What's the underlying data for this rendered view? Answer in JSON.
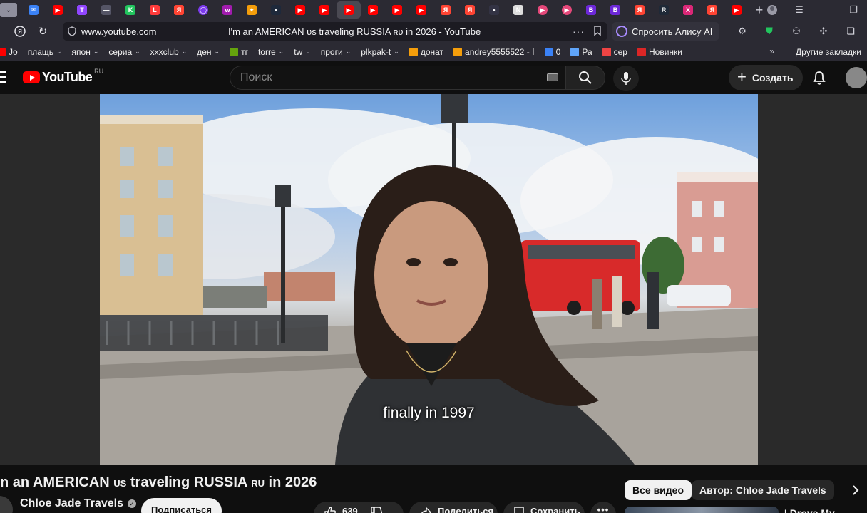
{
  "browser": {
    "tab_favicons": [
      {
        "icon": "mail-icon",
        "color": "#3b82f6",
        "glyph": "✉"
      },
      {
        "icon": "youtube-icon",
        "color": "#ff0000",
        "glyph": "▶"
      },
      {
        "icon": "twitch-icon",
        "color": "#9146ff",
        "glyph": "T"
      },
      {
        "icon": "site-icon",
        "color": "#555566",
        "glyph": "—"
      },
      {
        "icon": "kinopoisk-icon",
        "color": "#22c55e",
        "glyph": "K"
      },
      {
        "icon": "live-icon",
        "color": "#ff3b3b",
        "glyph": "L"
      },
      {
        "icon": "yandex-icon",
        "color": "#ff4433",
        "glyph": "Я"
      },
      {
        "icon": "circle-icon",
        "color": "#7c3aed",
        "glyph": "◯"
      },
      {
        "icon": "wb-icon",
        "color": "#a21caf",
        "glyph": "w"
      },
      {
        "icon": "fire-icon",
        "color": "#f59e0b",
        "glyph": "✦"
      },
      {
        "icon": "dark-site-icon",
        "color": "#1e293b",
        "glyph": "•"
      },
      {
        "icon": "youtube-icon",
        "color": "#ff0000",
        "glyph": "▶"
      },
      {
        "icon": "youtube-icon",
        "color": "#ff0000",
        "glyph": "▶"
      },
      {
        "icon": "youtube-icon",
        "color": "#ff0000",
        "glyph": "▶"
      },
      {
        "icon": "youtube-icon",
        "color": "#ff0000",
        "glyph": "▶"
      },
      {
        "icon": "youtube-icon",
        "color": "#ff0000",
        "glyph": "▶"
      },
      {
        "icon": "youtube-icon",
        "color": "#ff0000",
        "glyph": "▶"
      },
      {
        "icon": "yandex-icon",
        "color": "#ff4433",
        "glyph": "Я"
      },
      {
        "icon": "yandex-icon",
        "color": "#ff4433",
        "glyph": "Я"
      },
      {
        "icon": "dots-icon",
        "color": "#333344",
        "glyph": "•"
      },
      {
        "icon": "news-icon",
        "color": "#dddddd",
        "glyph": "N"
      },
      {
        "icon": "play-circle-icon",
        "color": "#e5487a",
        "glyph": "▶"
      },
      {
        "icon": "play-circle-icon",
        "color": "#e5487a",
        "glyph": "▶"
      },
      {
        "icon": "b-icon",
        "color": "#6d28d9",
        "glyph": "B"
      },
      {
        "icon": "b-icon",
        "color": "#6d28d9",
        "glyph": "B"
      },
      {
        "icon": "yandex-icon",
        "color": "#ff4433",
        "glyph": "Я"
      },
      {
        "icon": "r-icon",
        "color": "#1f2937",
        "glyph": "R"
      },
      {
        "icon": "x-icon",
        "color": "#db2777",
        "glyph": "X"
      },
      {
        "icon": "yandex-icon",
        "color": "#ff4433",
        "glyph": "Я"
      },
      {
        "icon": "youtube-icon",
        "color": "#ff0000",
        "glyph": "▶"
      }
    ],
    "active_tab_index": 13,
    "url": "www.youtube.com",
    "page_title": "I'm an AMERICAN ᴜs traveling RUSSIA ʀᴜ in 2026 - YouTube",
    "alice_label": "Спросить Алису AI",
    "bookmarks": [
      {
        "label": "Jo",
        "color": "#ff0000",
        "chevron": false
      },
      {
        "label": "плащь",
        "color": "",
        "chevron": true
      },
      {
        "label": "япон",
        "color": "",
        "chevron": true
      },
      {
        "label": "сериа",
        "color": "",
        "chevron": true
      },
      {
        "label": "xxxclub",
        "color": "",
        "chevron": true
      },
      {
        "label": "ден",
        "color": "",
        "chevron": true
      },
      {
        "label": "тг",
        "color": "#65a30d",
        "chevron": false
      },
      {
        "label": "torre",
        "color": "",
        "chevron": true
      },
      {
        "label": "tw",
        "color": "",
        "chevron": true
      },
      {
        "label": "проги",
        "color": "",
        "chevron": true
      },
      {
        "label": "plkpak-t",
        "color": "",
        "chevron": true
      },
      {
        "label": "донат",
        "color": "#f59e0b",
        "chevron": false
      },
      {
        "label": "andrey5555522 - Ⅰ",
        "color": "#f59e0b",
        "chevron": false
      },
      {
        "label": "0",
        "color": "#3b82f6",
        "chevron": false
      },
      {
        "label": "Ра",
        "color": "#60a5fa",
        "chevron": false
      },
      {
        "label": "сер",
        "color": "#ef4444",
        "chevron": false
      },
      {
        "label": "Новинки",
        "color": "#dc2626",
        "chevron": false
      }
    ],
    "bookmarks_more": "»",
    "other_bookmarks": "Другие закладки"
  },
  "youtube": {
    "logo_text": "YouTube",
    "country_code": "RU",
    "search_placeholder": "Поиск",
    "create_label": "Создать",
    "caption": "finally in 1997",
    "title_prefix": "n an AMERICAN ",
    "title_us": "US",
    "title_middle": " traveling RUSSIA ",
    "title_ru": "RU",
    "title_suffix": " in 2026",
    "channel_name": "Chloe Jade Travels",
    "subscribe_label": "Подписаться",
    "like_count": "639",
    "share_label": "Поделиться",
    "save_label": "Сохранить",
    "chips": {
      "all_videos": "Все видео",
      "by_author": "Автор: Chloe Jade Travels"
    },
    "recommendation_title": "I Drove My"
  }
}
